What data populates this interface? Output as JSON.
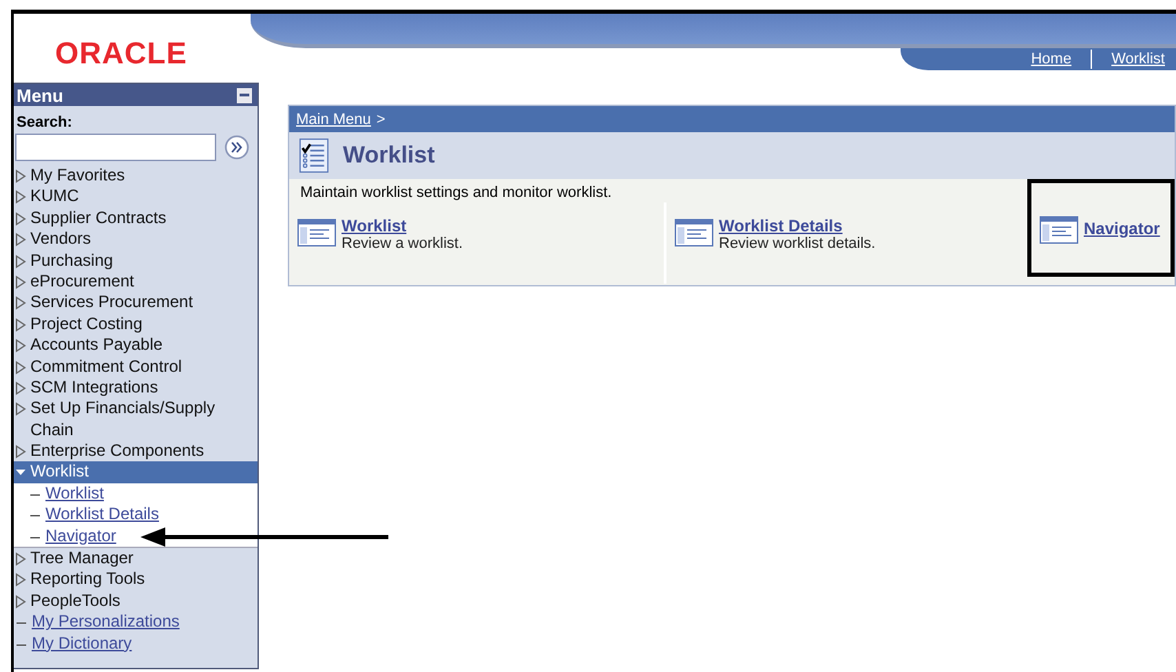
{
  "logo": "ORACLE",
  "header_links": [
    "Home",
    "Worklist"
  ],
  "menu": {
    "title": "Menu",
    "search_label": "Search:",
    "items": [
      {
        "kind": "folder",
        "label": "My Favorites",
        "expanded": false
      },
      {
        "kind": "folder",
        "label": "KUMC",
        "expanded": false
      },
      {
        "kind": "folder",
        "label": "Supplier Contracts",
        "expanded": false
      },
      {
        "kind": "folder",
        "label": "Vendors",
        "expanded": false
      },
      {
        "kind": "folder",
        "label": "Purchasing",
        "expanded": false
      },
      {
        "kind": "folder",
        "label": "eProcurement",
        "expanded": false
      },
      {
        "kind": "folder",
        "label": "Services Procurement",
        "expanded": false
      },
      {
        "kind": "folder",
        "label": "Project Costing",
        "expanded": false
      },
      {
        "kind": "folder",
        "label": "Accounts Payable",
        "expanded": false
      },
      {
        "kind": "folder",
        "label": "Commitment Control",
        "expanded": false
      },
      {
        "kind": "folder",
        "label": "SCM Integrations",
        "expanded": false
      },
      {
        "kind": "folder",
        "label": "Set Up Financials/Supply Chain",
        "expanded": false
      },
      {
        "kind": "folder",
        "label": "Enterprise Components",
        "expanded": false
      },
      {
        "kind": "folder",
        "label": "Worklist",
        "expanded": true,
        "children": [
          {
            "kind": "link",
            "label": "Worklist"
          },
          {
            "kind": "link",
            "label": "Worklist Details"
          },
          {
            "kind": "link",
            "label": "Navigator"
          }
        ]
      },
      {
        "kind": "folder",
        "label": "Tree Manager",
        "expanded": false
      },
      {
        "kind": "folder",
        "label": "Reporting Tools",
        "expanded": false
      },
      {
        "kind": "folder",
        "label": "PeopleTools",
        "expanded": false
      },
      {
        "kind": "link",
        "label": "My Personalizations"
      },
      {
        "kind": "link",
        "label": "My Dictionary"
      }
    ]
  },
  "breadcrumb": [
    "Main Menu",
    ">"
  ],
  "page_title": "Worklist",
  "description": "Maintain worklist settings and monitor worklist.",
  "tiles": [
    {
      "title": "Worklist",
      "subtitle": "Review a worklist.",
      "highlighted": false
    },
    {
      "title": "Worklist Details",
      "subtitle": "Review worklist details.",
      "highlighted": false
    },
    {
      "title": "Navigator",
      "highlighted": true
    }
  ]
}
